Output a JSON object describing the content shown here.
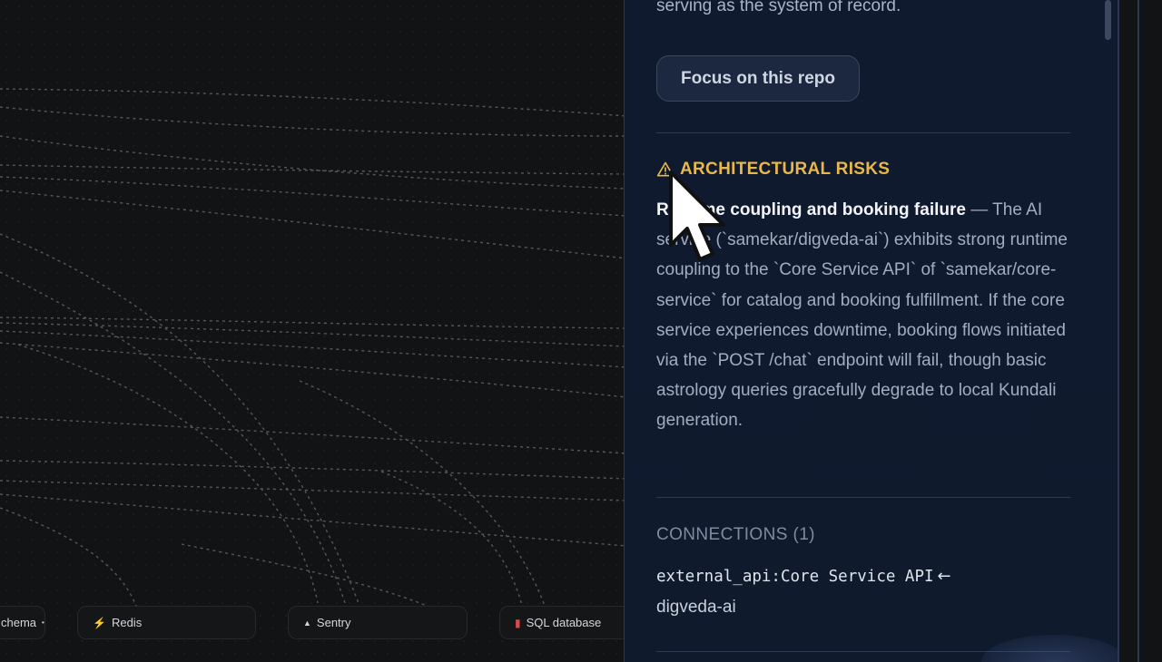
{
  "graph": {
    "nodes": [
      {
        "label": "chema",
        "icon": "•"
      },
      {
        "label": "Redis",
        "icon": "⚡"
      },
      {
        "label": "Sentry",
        "icon": "▲"
      },
      {
        "label": "SQL database",
        "icon": "▮"
      }
    ]
  },
  "panel": {
    "intro_tail": "serving as the system of record.",
    "focus_button_label": "Focus on this repo",
    "risks": {
      "icon": "warning-icon",
      "heading": "ARCHITECTURAL RISKS",
      "title": "Runtime coupling and booking failure",
      "separator": " — ",
      "body": "The AI service (`samekar/digveda-ai`) exhibits strong runtime coupling to the `Core Service API` of `samekar/core-service` for catalog and booking fulfillment. If the core service experiences downtime, booking flows initiated via the `POST /chat` endpoint will fail, though basic astrology queries gracefully degrade to local Kundali generation."
    },
    "connections": {
      "heading": "CONNECTIONS (1)",
      "items": [
        {
          "code": "external_api:Core Service API",
          "arrow": "←",
          "target": "digveda-ai"
        }
      ]
    }
  },
  "colors": {
    "panel_bg": "#101a2e",
    "accent_warning": "#e8b84a",
    "canvas_bg": "#121314"
  }
}
